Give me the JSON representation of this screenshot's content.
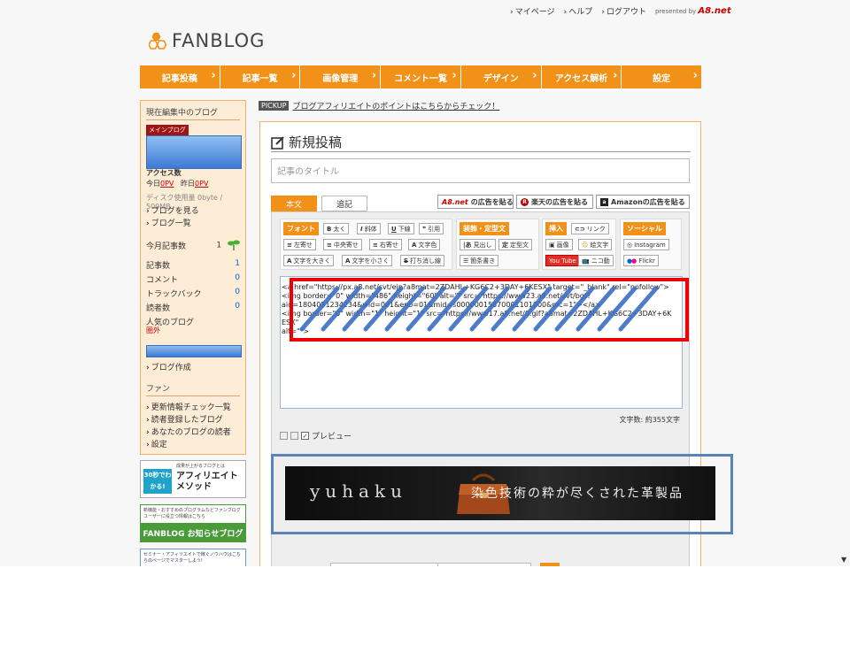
{
  "toplinks": {
    "mypage": "マイページ",
    "help": "ヘルプ",
    "logout": "ログアウト",
    "presented": "presented by",
    "a8": "A8.net"
  },
  "logo": {
    "text": "FANBLOG"
  },
  "nav": [
    "記事投稿",
    "記事一覧",
    "画像管理",
    "コメント一覧",
    "デザイン",
    "アクセス解析",
    "設定"
  ],
  "sidebar": {
    "editing_heading": "現在編集中のブログ",
    "main_badge": "メインブログ",
    "access_label": "アクセス数",
    "today_label": "今日",
    "today_value": "0PV",
    "yesterday_label": "昨日",
    "yesterday_value": "0PV",
    "disk": "ディスク使用量 0byte / 500MB",
    "view_blog": "ブログを見る",
    "blog_list": "ブログ一覧",
    "month_posts_label": "今月記事数",
    "month_posts_value": "1",
    "stats": [
      {
        "label": "記事数",
        "value": "1"
      },
      {
        "label": "コメント",
        "value": "0"
      },
      {
        "label": "トラックバック",
        "value": "0"
      },
      {
        "label": "読者数",
        "value": "0"
      }
    ],
    "popular_label": "人気のブログ",
    "popular_value": "圏外",
    "create_blog": "ブログ作成",
    "fan_heading": "ファン",
    "fan_links": [
      "更新情報チェック一覧",
      "読者登録したブログ",
      "あなたのブログの読者",
      "設定"
    ]
  },
  "banners": {
    "b1_small": "成果が上がるブログとは",
    "b1_badge": "30秒でわかる!",
    "b1_title": "アフィリエイトメソッド",
    "b2_small": "新機能・おすすめのプログラムなどファンブログユーザーに役立つ情報はこちら",
    "b2_title": "FANBLOG お知らせブログ",
    "b3_small": "セミナー・アフィリエイトで稼ぐノウハウはこちらのページでマスターしよう!"
  },
  "pickup": {
    "tag": "PICKUP",
    "text": "ブログアフィリエイトのポイントはこちらからチェック！"
  },
  "main": {
    "title": "新規投稿",
    "title_placeholder": "記事のタイトル",
    "tab_body": "本文",
    "tab_extra": "追記",
    "ad_a8": "の広告を貼る",
    "ad_a8_logo": "A8.net",
    "ad_rakuten": "楽天の広告を貼る",
    "ad_amazon": "Amazonの広告を貼る",
    "toolbar": {
      "font": "フォント",
      "bold": "太く",
      "italic": "斜体",
      "underline": "下線",
      "quote": "引用",
      "left": "左寄せ",
      "center": "中央寄せ",
      "right": "右寄せ",
      "color": "文字色",
      "bigger": "文字を大きく",
      "smaller": "文字を小さく",
      "strike": "打ち消し線",
      "decor": "装飾・定型文",
      "heading": "見出し",
      "template": "定型文",
      "bullets": "箇条書き",
      "insert": "挿入",
      "link": "リンク",
      "image": "画像",
      "emoji": "絵文字",
      "youtube": "You Tube",
      "niko": "ニコ動",
      "social": "ソーシャル",
      "instagram": "Instagram",
      "flickr": "Flickr"
    },
    "code": "<a href=\"https://px.a8.net/svt/ejp?a8mat=2ZDAHL+KG6C2+3DAY+6KESX\" target=\"_blank\" rel=\"nofollow\">\n<img border=\"0\" width=\"486\" height=\"60\" alt=\"\" src=\"https://www23.a8.net/svt/bgt?\naid=1804051234234&wid=001&eno=01&mid=s00000015870001101000&mc=1\"></a>\n<img border=\"0\" width=\"1\" height=\"1\" src=\"https://www17.a8.net/0.gif?a8mat=2ZDAHL+KG6C2+3DAY+6KESX\"\nalt=\"\">",
    "counter": "文字数: 約355文字",
    "preview": "プレビュー"
  },
  "ad": {
    "brand": "yuhaku",
    "copy": "染色技術の粋が尽くされた革製品"
  },
  "colors": {
    "accent": "#f29117",
    "highlight_red": "#e00000",
    "highlight_blue": "#5a84b8"
  }
}
